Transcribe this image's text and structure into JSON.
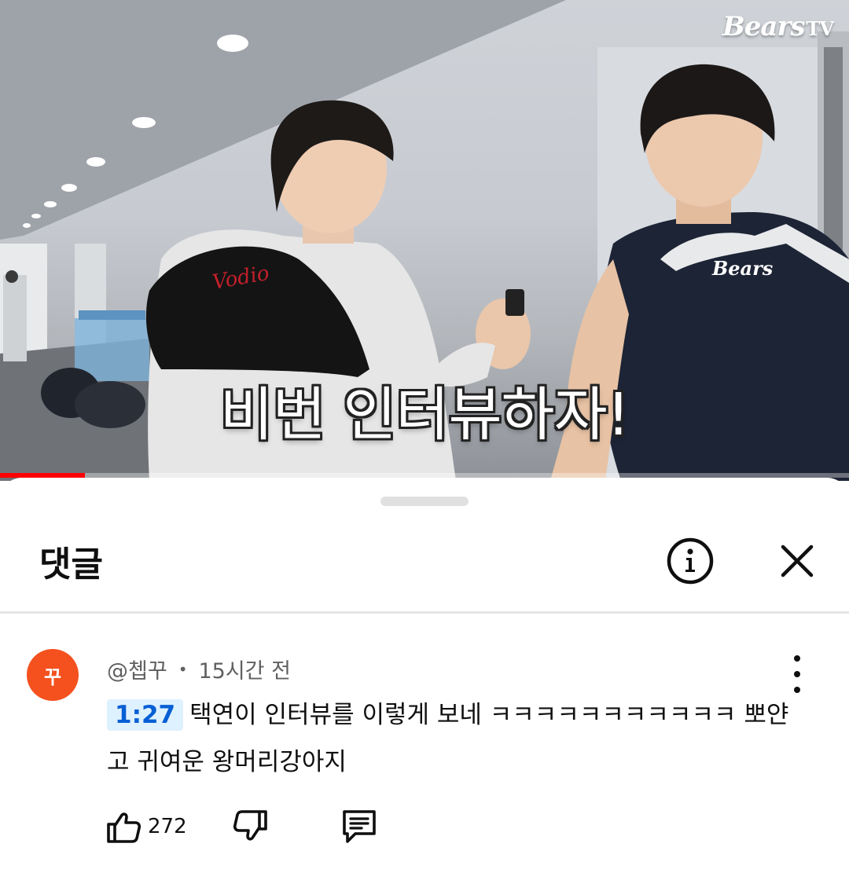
{
  "video": {
    "channel_logo": "Bears",
    "channel_logo_suffix": "TV",
    "caption": "비번 인터뷰하자!",
    "progress": 0.1,
    "jersey_text": "Bears",
    "brace_text": "Vodio"
  },
  "comments_sheet": {
    "title": "댓글",
    "icons": {
      "info": "info-icon",
      "close": "close-icon"
    }
  },
  "comment": {
    "avatar_initial": "꾸",
    "avatar_color": "#f4511e",
    "author": "@쳅꾸",
    "time_ago": "15시간 전",
    "timestamp": "1:27",
    "text": "택연이 인터뷰를 이렇게 보네 ㅋㅋㅋㅋㅋㅋㅋㅋㅋㅋㅋ 뽀얀고 귀여운 왕머리강아지",
    "like_count": "272",
    "icons": {
      "like": "thumbs-up-icon",
      "dislike": "thumbs-down-icon",
      "reply": "reply-icon",
      "more": "more-vert-icon"
    }
  },
  "colors": {
    "progress_red": "#ff0000",
    "timestamp_bg": "#def1ff",
    "timestamp_fg": "#065fd4"
  }
}
